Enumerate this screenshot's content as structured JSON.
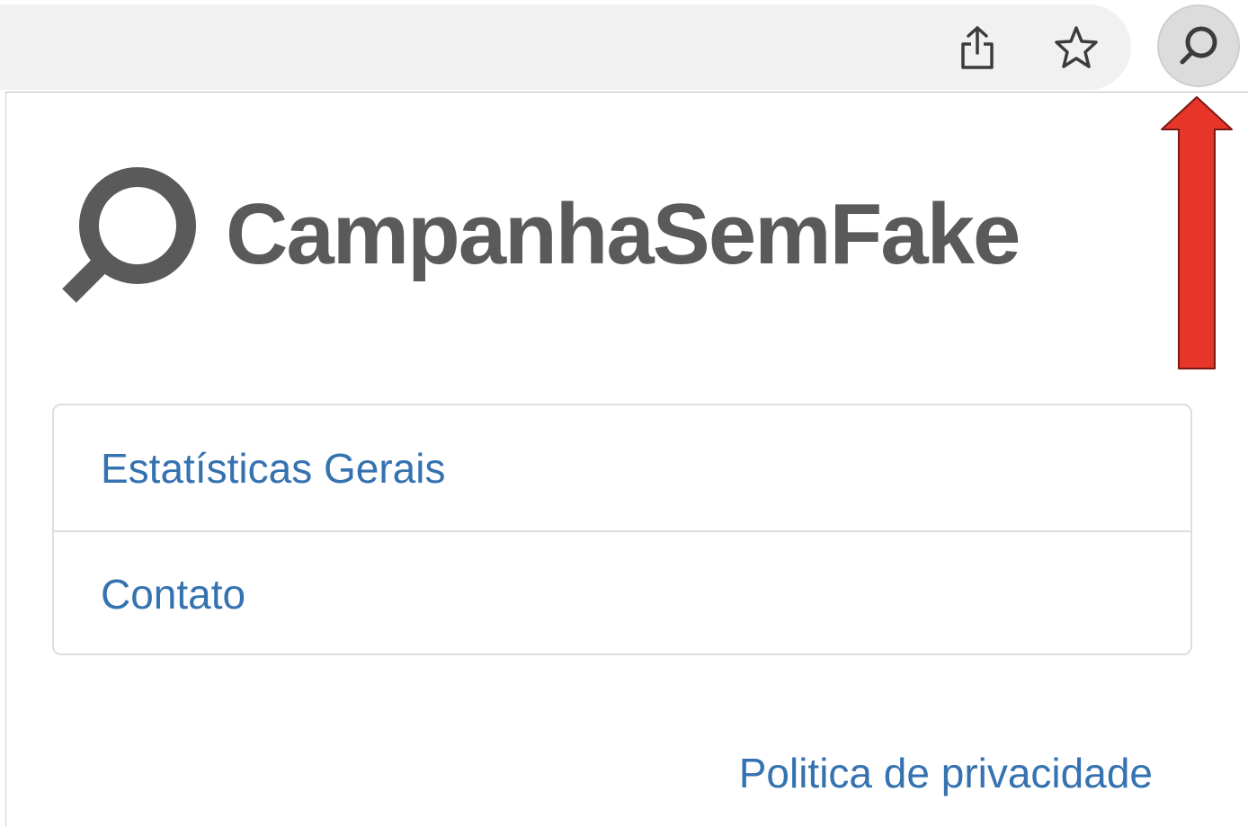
{
  "toolbar": {
    "share_icon": "share-icon",
    "star_icon": "star-outline-icon",
    "extension_icon": "magnifier-icon"
  },
  "popup": {
    "brand": "CampanhaSemFake",
    "logo_icon": "magnifier-logo-icon",
    "menu_items": [
      {
        "label": "Estatísticas Gerais"
      },
      {
        "label": "Contato"
      }
    ],
    "privacy_link": "Politica de privacidade"
  },
  "annotation": {
    "arrow_icon": "up-arrow-icon",
    "color": "#e8352a"
  },
  "colors": {
    "link": "#3572b0",
    "brand_text": "#5a5a5a",
    "toolbar_bg": "#f1f1f2"
  }
}
